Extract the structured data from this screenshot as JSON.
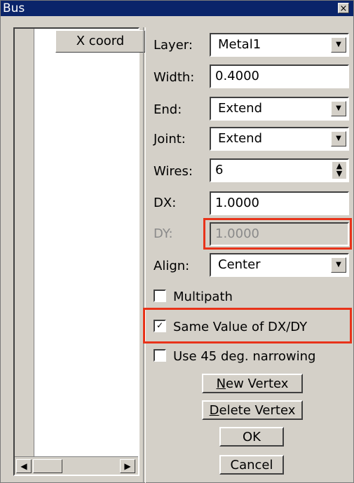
{
  "window": {
    "title": "Bus",
    "close_glyph": "×"
  },
  "list": {
    "column_header": "X coord",
    "scroll_left": "◀",
    "scroll_right": "▶"
  },
  "form": {
    "layer": {
      "label": "Layer:",
      "value": "Metal1"
    },
    "width": {
      "label": "Width:",
      "value": "0.4000"
    },
    "end": {
      "label": "End:",
      "value": "Extend"
    },
    "joint": {
      "label": "Joint:",
      "value": "Extend"
    },
    "wires": {
      "label": "Wires:",
      "value": "6"
    },
    "dx": {
      "label": "DX:",
      "value": "1.0000"
    },
    "dy": {
      "label": "DY:",
      "value": "1.0000",
      "disabled": true
    },
    "align": {
      "label": "Align:",
      "value": "Center"
    }
  },
  "options": {
    "multipath": {
      "label": "Multipath",
      "checked": false
    },
    "same_dx_dy": {
      "label": "Same Value of DX/DY",
      "checked": true
    },
    "narrowing": {
      "label": "Use 45 deg. narrowing",
      "checked": false
    }
  },
  "buttons": {
    "new_vertex": {
      "mnemonic": "N",
      "rest": "ew Vertex"
    },
    "delete_vertex": {
      "mnemonic": "D",
      "rest": "elete Vertex"
    },
    "ok": "OK",
    "cancel": "Cancel"
  },
  "colors": {
    "highlight": "#e8331a",
    "titlebar": "#0a246a",
    "face": "#d4d0c8"
  },
  "icons": {
    "dropdown": "chevron-down-icon",
    "spin": "spinner-icon",
    "check": "checkmark-icon"
  }
}
